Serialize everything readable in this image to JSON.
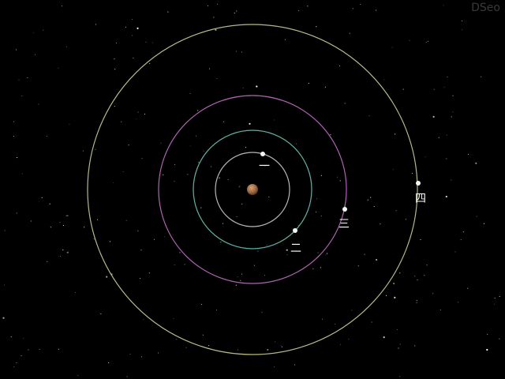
{
  "watermark": "DSeo",
  "colors": {
    "background": "#000000",
    "planet": "#a06a45",
    "moon": "#f4f4f4",
    "label": "#ffffff"
  },
  "planet": {
    "icon": "planet-icon"
  },
  "moons": [
    {
      "label": "一",
      "orbit_color": "#b8b8b8"
    },
    {
      "label": "二",
      "orbit_color": "#5fb3a6"
    },
    {
      "label": "三",
      "orbit_color": "#b064b2"
    },
    {
      "label": "四",
      "orbit_color": "#b9b987"
    }
  ]
}
